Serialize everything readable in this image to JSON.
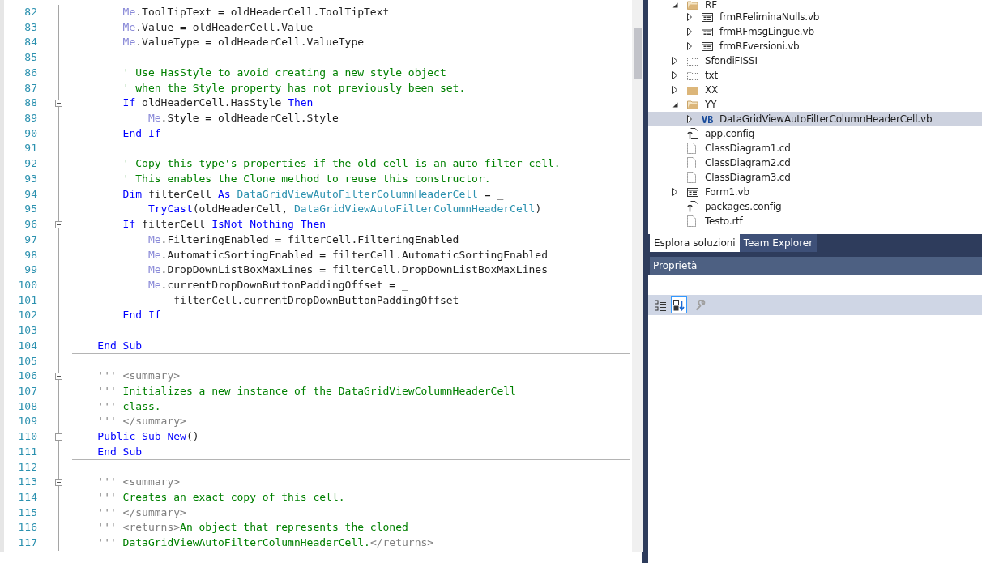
{
  "editor": {
    "lines": [
      {
        "number": "82",
        "fold": false,
        "divider_below": false,
        "tokens": [
          {
            "kind": "me",
            "text": "        Me"
          },
          {
            "kind": "plain",
            "text": ".ToolTipText = oldHeaderCell.ToolTipText"
          }
        ]
      },
      {
        "number": "83",
        "fold": false,
        "divider_below": false,
        "tokens": [
          {
            "kind": "me",
            "text": "        Me"
          },
          {
            "kind": "plain",
            "text": ".Value = oldHeaderCell.Value"
          }
        ]
      },
      {
        "number": "84",
        "fold": false,
        "divider_below": false,
        "tokens": [
          {
            "kind": "me",
            "text": "        Me"
          },
          {
            "kind": "plain",
            "text": ".ValueType = oldHeaderCell.ValueType"
          }
        ]
      },
      {
        "number": "85",
        "fold": false
      },
      {
        "number": "86",
        "fold": false,
        "divider_below": false,
        "tokens": [
          {
            "kind": "comment",
            "text": "        ' Use HasStyle to avoid creating a new style object"
          }
        ]
      },
      {
        "number": "87",
        "fold": false,
        "divider_below": false,
        "tokens": [
          {
            "kind": "comment",
            "text": "        ' when the Style property has not previously been set."
          }
        ]
      },
      {
        "number": "88",
        "fold": true,
        "divider_below": false,
        "tokens": [
          {
            "kind": "keyword",
            "text": "        If"
          },
          {
            "kind": "plain",
            "text": " oldHeaderCell.HasStyle "
          },
          {
            "kind": "keyword",
            "text": "Then"
          }
        ]
      },
      {
        "number": "89",
        "fold": false,
        "divider_below": false,
        "tokens": [
          {
            "kind": "me",
            "text": "            Me"
          },
          {
            "kind": "plain",
            "text": ".Style = oldHeaderCell.Style"
          }
        ]
      },
      {
        "number": "90",
        "fold": false,
        "divider_below": false,
        "tokens": [
          {
            "kind": "keyword",
            "text": "        End If"
          }
        ]
      },
      {
        "number": "91",
        "fold": false
      },
      {
        "number": "92",
        "fold": false,
        "divider_below": false,
        "tokens": [
          {
            "kind": "comment",
            "text": "        ' Copy this type's properties if the old cell is an auto-filter cell."
          }
        ]
      },
      {
        "number": "93",
        "fold": false,
        "divider_below": false,
        "tokens": [
          {
            "kind": "comment",
            "text": "        ' This enables the Clone method to reuse this constructor."
          }
        ]
      },
      {
        "number": "94",
        "fold": false,
        "divider_below": false,
        "tokens": [
          {
            "kind": "keyword",
            "text": "        Dim"
          },
          {
            "kind": "plain",
            "text": " filterCell "
          },
          {
            "kind": "keyword",
            "text": "As"
          },
          {
            "kind": "type",
            "text": " DataGridViewAutoFilterColumnHeaderCell"
          },
          {
            "kind": "plain",
            "text": " = _"
          }
        ]
      },
      {
        "number": "95",
        "fold": false,
        "divider_below": false,
        "tokens": [
          {
            "kind": "keyword",
            "text": "            TryCast"
          },
          {
            "kind": "plain",
            "text": "(oldHeaderCell, "
          },
          {
            "kind": "type",
            "text": "DataGridViewAutoFilterColumnHeaderCell"
          },
          {
            "kind": "plain",
            "text": ")"
          }
        ]
      },
      {
        "number": "96",
        "fold": true,
        "divider_below": false,
        "tokens": [
          {
            "kind": "keyword",
            "text": "        If"
          },
          {
            "kind": "plain",
            "text": " filterCell "
          },
          {
            "kind": "keyword",
            "text": "IsNot Nothing Then"
          }
        ]
      },
      {
        "number": "97",
        "fold": false,
        "divider_below": false,
        "tokens": [
          {
            "kind": "me",
            "text": "            Me"
          },
          {
            "kind": "plain",
            "text": ".FilteringEnabled = filterCell.FilteringEnabled"
          }
        ]
      },
      {
        "number": "98",
        "fold": false,
        "divider_below": false,
        "tokens": [
          {
            "kind": "me",
            "text": "            Me"
          },
          {
            "kind": "plain",
            "text": ".AutomaticSortingEnabled = filterCell.AutomaticSortingEnabled"
          }
        ]
      },
      {
        "number": "99",
        "fold": false,
        "divider_below": false,
        "tokens": [
          {
            "kind": "me",
            "text": "            Me"
          },
          {
            "kind": "plain",
            "text": ".DropDownListBoxMaxLines = filterCell.DropDownListBoxMaxLines"
          }
        ]
      },
      {
        "number": "100",
        "fold": false,
        "divider_below": false,
        "tokens": [
          {
            "kind": "me",
            "text": "            Me"
          },
          {
            "kind": "plain",
            "text": ".currentDropDownButtonPaddingOffset = _"
          }
        ]
      },
      {
        "number": "101",
        "fold": false,
        "divider_below": false,
        "tokens": [
          {
            "kind": "plain",
            "text": "                filterCell.currentDropDownButtonPaddingOffset"
          }
        ]
      },
      {
        "number": "102",
        "fold": false,
        "divider_below": false,
        "tokens": [
          {
            "kind": "keyword",
            "text": "        End If"
          }
        ]
      },
      {
        "number": "103",
        "fold": false
      },
      {
        "number": "104",
        "fold": false,
        "divider_below": true,
        "tokens": [
          {
            "kind": "keyword",
            "text": "    End Sub"
          }
        ]
      },
      {
        "number": "105",
        "fold": false
      },
      {
        "number": "106",
        "fold": true,
        "divider_below": false,
        "tokens": [
          {
            "kind": "doc",
            "text": "    ''' <summary>"
          }
        ]
      },
      {
        "number": "107",
        "fold": false,
        "divider_below": false,
        "tokens": [
          {
            "kind": "doc",
            "text": "    '''"
          },
          {
            "kind": "comment",
            "text": " Initializes a new instance of the DataGridViewColumnHeaderCell"
          }
        ]
      },
      {
        "number": "108",
        "fold": false,
        "divider_below": false,
        "tokens": [
          {
            "kind": "doc",
            "text": "    '''"
          },
          {
            "kind": "comment",
            "text": " class."
          }
        ]
      },
      {
        "number": "109",
        "fold": false,
        "divider_below": false,
        "tokens": [
          {
            "kind": "doc",
            "text": "    ''' </summary>"
          }
        ]
      },
      {
        "number": "110",
        "fold": true,
        "divider_below": false,
        "tokens": [
          {
            "kind": "keyword",
            "text": "    Public Sub New"
          },
          {
            "kind": "plain",
            "text": "()"
          }
        ]
      },
      {
        "number": "111",
        "fold": false,
        "divider_below": true,
        "tokens": [
          {
            "kind": "keyword",
            "text": "    End Sub"
          }
        ]
      },
      {
        "number": "112",
        "fold": false
      },
      {
        "number": "113",
        "fold": true,
        "divider_below": false,
        "tokens": [
          {
            "kind": "doc",
            "text": "    ''' <summary>"
          }
        ]
      },
      {
        "number": "114",
        "fold": false,
        "divider_below": false,
        "tokens": [
          {
            "kind": "doc",
            "text": "    '''"
          },
          {
            "kind": "comment",
            "text": " Creates an exact copy of this cell."
          }
        ]
      },
      {
        "number": "115",
        "fold": false,
        "divider_below": false,
        "tokens": [
          {
            "kind": "doc",
            "text": "    ''' </summary>"
          }
        ]
      },
      {
        "number": "116",
        "fold": false,
        "divider_below": false,
        "tokens": [
          {
            "kind": "doc",
            "text": "    ''' <returns>"
          },
          {
            "kind": "comment",
            "text": "An object that represents the cloned"
          }
        ]
      },
      {
        "number": "117",
        "fold": false,
        "divider_below": false,
        "tokens": [
          {
            "kind": "doc",
            "text": "    '''"
          },
          {
            "kind": "comment",
            "text": " DataGridViewAutoFilterColumnHeaderCell."
          },
          {
            "kind": "doc",
            "text": "</returns>"
          }
        ]
      }
    ]
  },
  "solution_explorer": {
    "items": [
      {
        "label": "RF",
        "kind": "folder-open",
        "expanded": true,
        "selected": false,
        "children": [
          {
            "label": "frmRFeliminaNulls.vb",
            "kind": "form",
            "expanded": false,
            "selected": false
          },
          {
            "label": "frmRFmsgLingue.vb",
            "kind": "form",
            "expanded": false,
            "selected": false
          },
          {
            "label": "frmRFversioni.vb",
            "kind": "form",
            "expanded": false,
            "selected": false
          }
        ]
      },
      {
        "label": "SfondiFISSI",
        "kind": "folder-excluded",
        "expanded": false,
        "selected": false
      },
      {
        "label": "txt",
        "kind": "folder-excluded",
        "expanded": false,
        "selected": false
      },
      {
        "label": "XX",
        "kind": "folder",
        "expanded": false,
        "selected": false
      },
      {
        "label": "YY",
        "kind": "folder-open",
        "expanded": true,
        "selected": false,
        "children": [
          {
            "label": "DataGridViewAutoFilterColumnHeaderCell.vb",
            "kind": "vb",
            "expanded": false,
            "selected": true
          }
        ]
      },
      {
        "label": "app.config",
        "kind": "config",
        "selected": false
      },
      {
        "label": "ClassDiagram1.cd",
        "kind": "file",
        "selected": false
      },
      {
        "label": "ClassDiagram2.cd",
        "kind": "file",
        "selected": false
      },
      {
        "label": "ClassDiagram3.cd",
        "kind": "file",
        "selected": false
      },
      {
        "label": "Form1.vb",
        "kind": "form",
        "expanded": false,
        "selected": false
      },
      {
        "label": "packages.config",
        "kind": "config",
        "selected": false
      },
      {
        "label": "Testo.rtf",
        "kind": "file",
        "selected": false
      }
    ]
  },
  "tabs": [
    {
      "label": "Esplora soluzioni",
      "selected": true
    },
    {
      "label": "Team Explorer",
      "selected": false
    }
  ],
  "properties": {
    "title": "Proprietà",
    "toolbar": [
      {
        "kind": "categorized",
        "selected": false,
        "disabled": false
      },
      {
        "kind": "alphabetical",
        "selected": true,
        "disabled": false
      },
      {
        "kind": "property-pages",
        "selected": false,
        "disabled": true
      }
    ]
  }
}
